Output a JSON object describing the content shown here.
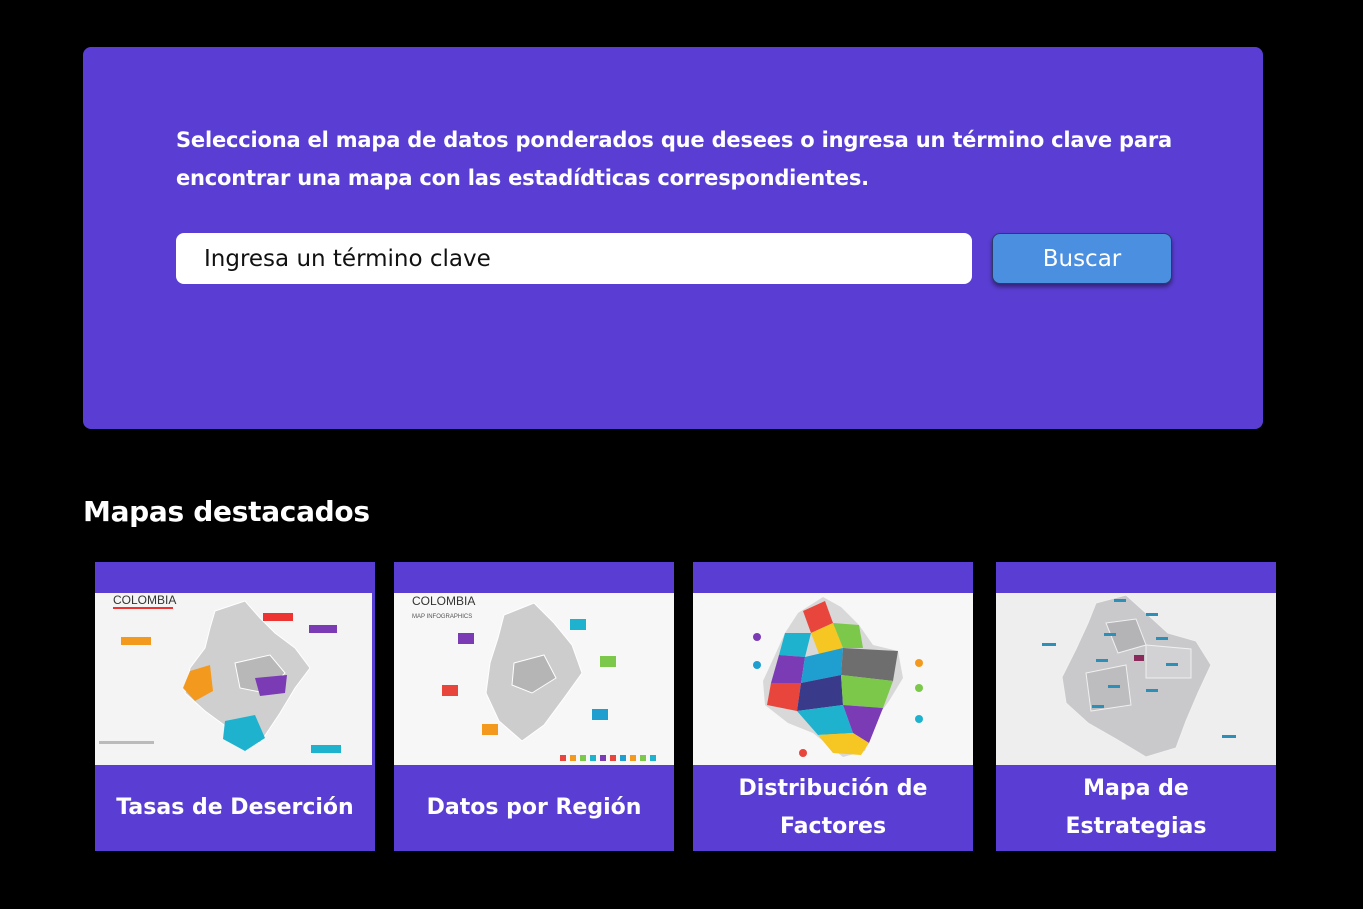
{
  "search": {
    "intro": "Selecciona el mapa de datos ponderados que desees o ingresa un término clave para encontrar una mapa con las estadídticas correspondientes.",
    "input_value": "Ingresa un término clave",
    "button_label": "Buscar"
  },
  "featured": {
    "title": "Mapas destacados",
    "cards": [
      {
        "label": "Tasas de Deserción",
        "thumb_title": "COLOMBIA"
      },
      {
        "label": "Datos por Región",
        "thumb_title": "COLOMBIA",
        "thumb_subtitle": "MAP INFOGRAPHICS"
      },
      {
        "label": "Distribución de Factores"
      },
      {
        "label": "Mapa de Estrategias"
      }
    ]
  },
  "colors": {
    "panel": "#5a3ed4",
    "button": "#4a8fe0",
    "background": "#000000"
  }
}
